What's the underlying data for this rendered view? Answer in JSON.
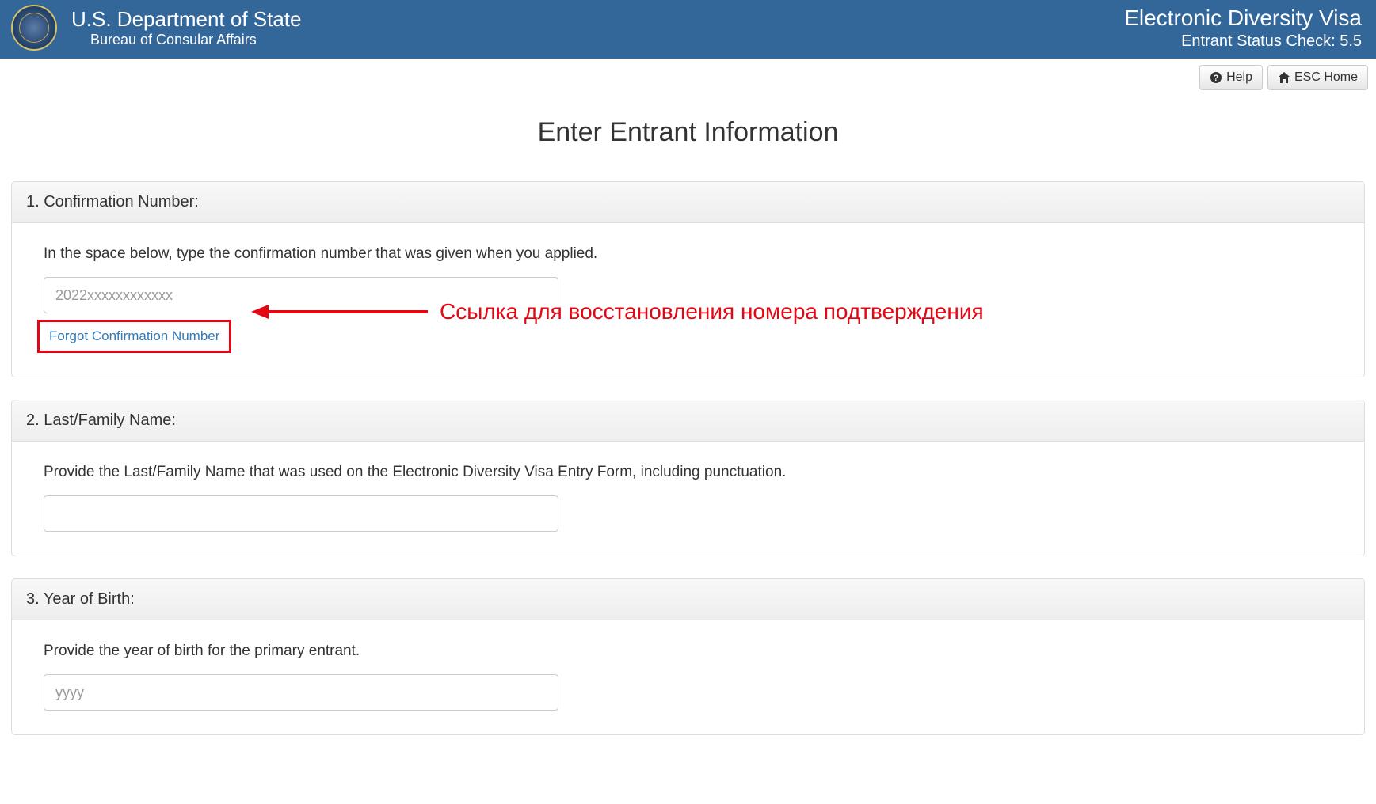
{
  "header": {
    "dept_title": "U.S. Department of State",
    "dept_subtitle": "Bureau of Consular Affairs",
    "app_title": "Electronic Diversity Visa",
    "app_subtitle": "Entrant Status Check: 5.5"
  },
  "toolbar": {
    "help_label": "Help",
    "home_label": "ESC Home"
  },
  "page": {
    "title": "Enter Entrant Information"
  },
  "sections": {
    "confirmation": {
      "heading": "1. Confirmation Number:",
      "instruction": "In the space below, type the confirmation number that was given when you applied.",
      "placeholder": "2022xxxxxxxxxxxx",
      "forgot_label": "Forgot Confirmation Number"
    },
    "lastname": {
      "heading": "2. Last/Family Name:",
      "instruction": "Provide the Last/Family Name that was used on the Electronic Diversity Visa Entry Form, including punctuation."
    },
    "yob": {
      "heading": "3. Year of Birth:",
      "instruction": "Provide the year of birth for the primary entrant.",
      "placeholder": "yyyy"
    }
  },
  "annotation": {
    "text": "Ссылка для восстановления номера подтверждения",
    "color": "#e30613"
  }
}
